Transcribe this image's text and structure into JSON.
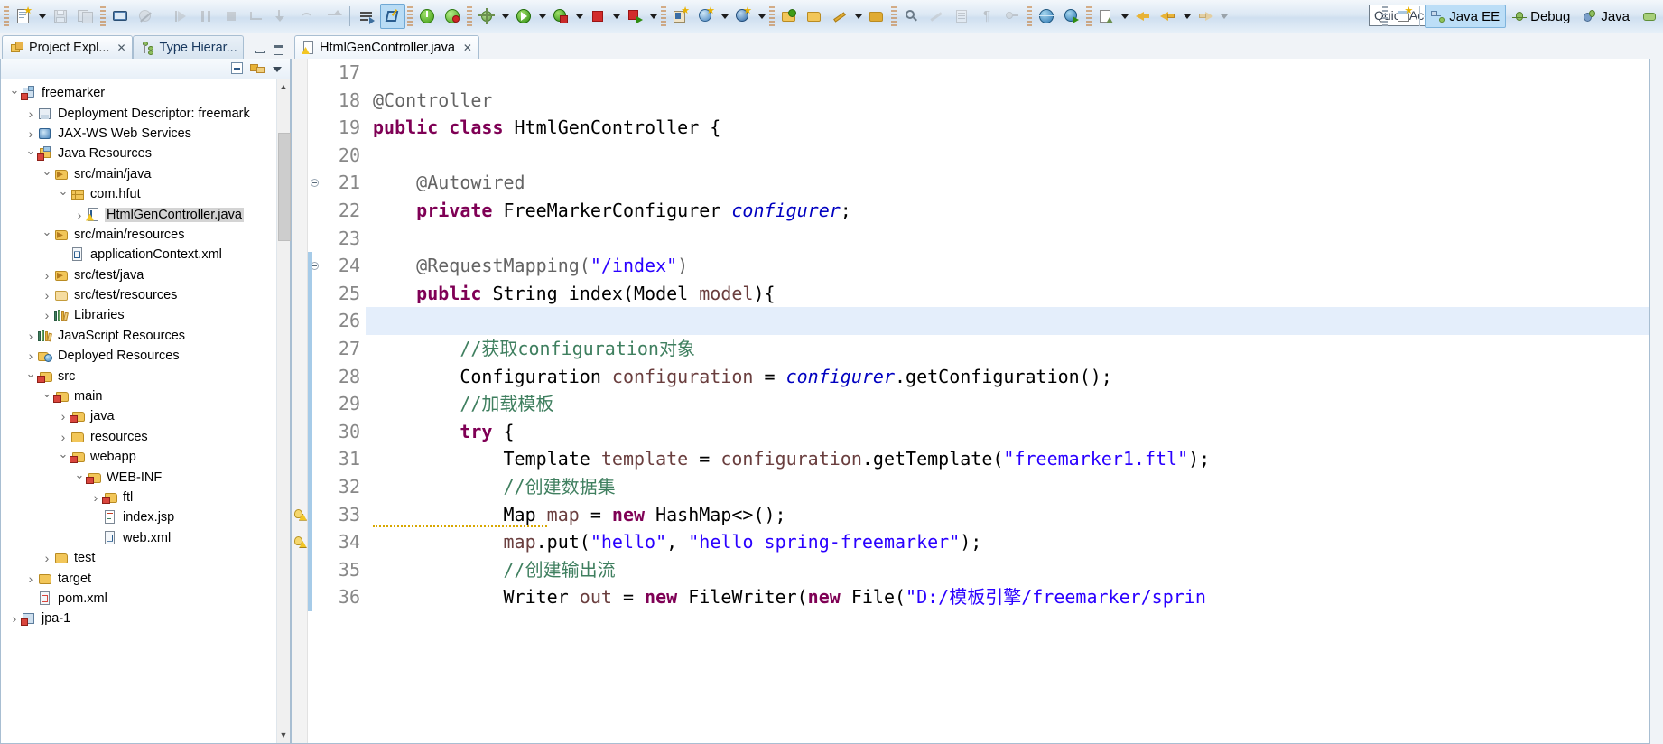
{
  "window": {
    "quick_access_placeholder": "Quick Access",
    "perspectives": [
      {
        "label": "Java EE",
        "icon": "javaee-perspective-icon",
        "selected": true
      },
      {
        "label": "Debug",
        "icon": "debug-perspective-icon",
        "selected": false
      },
      {
        "label": "Java",
        "icon": "java-perspective-icon",
        "selected": false
      }
    ],
    "open_perspective_icon": "open-perspective-icon"
  },
  "toolbar": {
    "groups": [
      {
        "name": "file",
        "items": [
          {
            "icon": "new-wizard-icon",
            "enabled": true,
            "dropdown": true
          },
          {
            "icon": "save-icon",
            "enabled": false
          },
          {
            "icon": "save-all-icon",
            "enabled": false
          }
        ]
      },
      {
        "name": "print-group",
        "items": [
          {
            "icon": "print-icon",
            "enabled": true
          },
          {
            "icon": "toggle-breakpoint-icon",
            "enabled": false
          }
        ]
      },
      {
        "name": "debug-step",
        "items": [
          {
            "icon": "resume-icon",
            "enabled": false
          },
          {
            "icon": "suspend-icon",
            "enabled": false
          },
          {
            "icon": "terminate-icon",
            "enabled": false
          },
          {
            "icon": "disconnect-icon",
            "enabled": false
          },
          {
            "icon": "step-into-icon",
            "enabled": false
          },
          {
            "icon": "step-over-icon",
            "enabled": false
          },
          {
            "icon": "step-return-icon",
            "enabled": false
          }
        ]
      },
      {
        "name": "build",
        "items": [
          {
            "icon": "skip-all-breakpoints-icon",
            "enabled": true
          },
          {
            "icon": "last-edit-location-icon",
            "enabled": true,
            "active": true
          }
        ]
      },
      {
        "name": "server",
        "items": [
          {
            "icon": "server-start-icon",
            "enabled": true
          },
          {
            "icon": "server-publish-icon",
            "enabled": true
          }
        ]
      },
      {
        "name": "run",
        "items": [
          {
            "icon": "debug-run-icon",
            "enabled": true,
            "dropdown": true
          },
          {
            "icon": "run-icon",
            "enabled": true,
            "dropdown": true
          },
          {
            "icon": "run-coverage-icon",
            "enabled": true,
            "dropdown": true
          },
          {
            "icon": "stop-icon",
            "enabled": true,
            "dropdown": true
          },
          {
            "icon": "run-on-server-icon",
            "enabled": true,
            "dropdown": true
          },
          {
            "icon": "profile-icon",
            "enabled": true,
            "dropdown": true
          }
        ]
      },
      {
        "name": "java-new",
        "items": [
          {
            "icon": "new-java-project-icon",
            "enabled": true
          },
          {
            "icon": "new-web-project-icon",
            "enabled": true,
            "dropdown": true
          },
          {
            "icon": "new-spring-bean-icon",
            "enabled": true,
            "dropdown": true
          }
        ]
      },
      {
        "name": "resources",
        "items": [
          {
            "icon": "open-type-icon",
            "enabled": true
          },
          {
            "icon": "open-task-icon",
            "enabled": true
          },
          {
            "icon": "new-annotation-icon",
            "enabled": true,
            "dropdown": true
          },
          {
            "icon": "open-resource-icon",
            "enabled": true
          }
        ]
      },
      {
        "name": "search",
        "items": [
          {
            "icon": "search-icon",
            "enabled": true
          },
          {
            "icon": "pencil-icon",
            "enabled": false
          },
          {
            "icon": "outline-icon",
            "enabled": false
          },
          {
            "icon": "paragraph-icon",
            "enabled": false
          },
          {
            "icon": "link-icon",
            "enabled": false
          }
        ]
      },
      {
        "name": "web",
        "items": [
          {
            "icon": "globe-icon",
            "enabled": true
          },
          {
            "icon": "web-run-icon",
            "enabled": true
          }
        ]
      },
      {
        "name": "nav",
        "items": [
          {
            "icon": "external-tools-icon",
            "enabled": true,
            "dropdown": true
          },
          {
            "icon": "previous-annotation-icon",
            "enabled": true,
            "dropdown": true
          },
          {
            "icon": "next-annotation-icon",
            "enabled": true
          },
          {
            "icon": "back-icon",
            "enabled": true,
            "dropdown": true
          },
          {
            "icon": "forward-icon",
            "enabled": true,
            "dropdown": true
          }
        ]
      }
    ]
  },
  "left_panel": {
    "tabs": [
      {
        "label": "Project Expl...",
        "icon": "project-explorer-icon",
        "active": true,
        "closable": true
      },
      {
        "label": "Type Hierar...",
        "icon": "type-hierarchy-icon",
        "active": false,
        "closable": false
      }
    ],
    "window_buttons": [
      "minimize-view-button",
      "maximize-view-button"
    ],
    "view_toolbar": [
      "collapse-all-icon",
      "link-with-editor-icon",
      "view-menu-icon"
    ],
    "tree": [
      {
        "depth": 0,
        "label": "freemarker",
        "icon": "maven-web-project-icon",
        "state": "open"
      },
      {
        "depth": 1,
        "label": "Deployment Descriptor: freemark",
        "icon": "deployment-descriptor-icon",
        "state": "closed"
      },
      {
        "depth": 1,
        "label": "JAX-WS Web Services",
        "icon": "jaxws-icon",
        "state": "closed"
      },
      {
        "depth": 1,
        "label": "Java Resources",
        "icon": "java-resources-icon",
        "state": "open"
      },
      {
        "depth": 2,
        "label": "src/main/java",
        "icon": "source-folder-icon",
        "state": "open"
      },
      {
        "depth": 3,
        "label": "com.hfut",
        "icon": "package-icon",
        "state": "open"
      },
      {
        "depth": 4,
        "label": "HtmlGenController.java",
        "icon": "java-file-warning-icon",
        "state": "closed",
        "selected": true
      },
      {
        "depth": 2,
        "label": "src/main/resources",
        "icon": "source-folder-icon",
        "state": "open"
      },
      {
        "depth": 3,
        "label": "applicationContext.xml",
        "icon": "xml-file-icon",
        "state": "leaf"
      },
      {
        "depth": 2,
        "label": "src/test/java",
        "icon": "source-folder-icon",
        "state": "closed"
      },
      {
        "depth": 2,
        "label": "src/test/resources",
        "icon": "source-folder-empty-icon",
        "state": "closed"
      },
      {
        "depth": 2,
        "label": "Libraries",
        "icon": "libraries-icon",
        "state": "closed"
      },
      {
        "depth": 1,
        "label": "JavaScript Resources",
        "icon": "libraries-icon",
        "state": "closed"
      },
      {
        "depth": 1,
        "label": "Deployed Resources",
        "icon": "deployed-resources-icon",
        "state": "closed"
      },
      {
        "depth": 1,
        "label": "src",
        "icon": "folder-warning-icon",
        "state": "open"
      },
      {
        "depth": 2,
        "label": "main",
        "icon": "folder-warning-icon",
        "state": "open"
      },
      {
        "depth": 3,
        "label": "java",
        "icon": "folder-warning-icon",
        "state": "closed"
      },
      {
        "depth": 3,
        "label": "resources",
        "icon": "folder-icon",
        "state": "closed"
      },
      {
        "depth": 3,
        "label": "webapp",
        "icon": "folder-warning-icon",
        "state": "open"
      },
      {
        "depth": 4,
        "label": "WEB-INF",
        "icon": "folder-warning-icon",
        "state": "open"
      },
      {
        "depth": 5,
        "label": "ftl",
        "icon": "folder-warning-icon",
        "state": "closed"
      },
      {
        "depth": 5,
        "label": "index.jsp",
        "icon": "jsp-file-icon",
        "state": "leaf"
      },
      {
        "depth": 5,
        "label": "web.xml",
        "icon": "xml-file-icon",
        "state": "leaf"
      },
      {
        "depth": 2,
        "label": "test",
        "icon": "folder-icon",
        "state": "closed"
      },
      {
        "depth": 1,
        "label": "target",
        "icon": "folder-icon",
        "state": "closed"
      },
      {
        "depth": 1,
        "label": "pom.xml",
        "icon": "pom-file-icon",
        "state": "leaf"
      },
      {
        "depth": 0,
        "label": "jpa-1",
        "icon": "java-project-icon",
        "state": "closed"
      }
    ]
  },
  "editor": {
    "tab": {
      "label": "HtmlGenController.java",
      "icon": "java-file-warning-icon",
      "closable": true
    },
    "current_line": 26,
    "lines": [
      {
        "n": 17,
        "tokens": [],
        "marker": null,
        "fold": null,
        "change": false
      },
      {
        "n": 18,
        "tokens": [
          {
            "t": "@Controller",
            "c": "ann"
          }
        ],
        "marker": null,
        "fold": null,
        "change": false
      },
      {
        "n": 19,
        "tokens": [
          {
            "t": "public",
            "c": "kw"
          },
          {
            "t": " ",
            "c": ""
          },
          {
            "t": "class",
            "c": "kw"
          },
          {
            "t": " HtmlGenController {",
            "c": ""
          }
        ],
        "marker": null,
        "fold": null,
        "change": false
      },
      {
        "n": 20,
        "tokens": [],
        "marker": null,
        "fold": null,
        "change": false
      },
      {
        "n": 21,
        "tokens": [
          {
            "t": "    @Autowired",
            "c": "ann"
          }
        ],
        "marker": null,
        "fold": "collapse",
        "change": false
      },
      {
        "n": 22,
        "tokens": [
          {
            "t": "    ",
            "c": ""
          },
          {
            "t": "private",
            "c": "kw"
          },
          {
            "t": " FreeMarkerConfigurer ",
            "c": ""
          },
          {
            "t": "configurer",
            "c": "fld2"
          },
          {
            "t": ";",
            "c": ""
          }
        ],
        "marker": null,
        "fold": null,
        "change": false
      },
      {
        "n": 23,
        "tokens": [],
        "marker": null,
        "fold": null,
        "change": false
      },
      {
        "n": 24,
        "tokens": [
          {
            "t": "    @RequestMapping(",
            "c": "ann"
          },
          {
            "t": "\"/index\"",
            "c": "str"
          },
          {
            "t": ")",
            "c": "ann"
          }
        ],
        "marker": null,
        "fold": "collapse",
        "change": true
      },
      {
        "n": 25,
        "tokens": [
          {
            "t": "    ",
            "c": ""
          },
          {
            "t": "public",
            "c": "kw"
          },
          {
            "t": " String index(Model ",
            "c": ""
          },
          {
            "t": "model",
            "c": "lv"
          },
          {
            "t": "){",
            "c": ""
          }
        ],
        "marker": null,
        "fold": null,
        "change": true
      },
      {
        "n": 26,
        "tokens": [],
        "marker": null,
        "fold": null,
        "change": true
      },
      {
        "n": 27,
        "tokens": [
          {
            "t": "        //获取configuration对象",
            "c": "cm"
          }
        ],
        "marker": null,
        "fold": null,
        "change": true
      },
      {
        "n": 28,
        "tokens": [
          {
            "t": "        Configuration ",
            "c": ""
          },
          {
            "t": "configuration",
            "c": "lv"
          },
          {
            "t": " = ",
            "c": ""
          },
          {
            "t": "configurer",
            "c": "fld2"
          },
          {
            "t": ".getConfiguration();",
            "c": ""
          }
        ],
        "marker": null,
        "fold": null,
        "change": true
      },
      {
        "n": 29,
        "tokens": [
          {
            "t": "        //加载模板",
            "c": "cm"
          }
        ],
        "marker": null,
        "fold": null,
        "change": true
      },
      {
        "n": 30,
        "tokens": [
          {
            "t": "        ",
            "c": ""
          },
          {
            "t": "try",
            "c": "kw"
          },
          {
            "t": " {",
            "c": ""
          }
        ],
        "marker": null,
        "fold": null,
        "change": true
      },
      {
        "n": 31,
        "tokens": [
          {
            "t": "            Template ",
            "c": ""
          },
          {
            "t": "template",
            "c": "lv"
          },
          {
            "t": " = ",
            "c": ""
          },
          {
            "t": "configuration",
            "c": "lv"
          },
          {
            "t": ".getTemplate(",
            "c": ""
          },
          {
            "t": "\"freemarker1.ftl\"",
            "c": "str"
          },
          {
            "t": ");",
            "c": ""
          }
        ],
        "marker": null,
        "fold": null,
        "change": true
      },
      {
        "n": 32,
        "tokens": [
          {
            "t": "            //创建数据集",
            "c": "cm"
          }
        ],
        "marker": null,
        "fold": null,
        "change": true
      },
      {
        "n": 33,
        "tokens": [
          {
            "t": "            Map ",
            "c": "warn"
          },
          {
            "t": "map",
            "c": "lv"
          },
          {
            "t": " = ",
            "c": ""
          },
          {
            "t": "new",
            "c": "kw"
          },
          {
            "t": " HashMap<>();",
            "c": ""
          }
        ],
        "marker": "warning-quickfix",
        "fold": null,
        "change": true
      },
      {
        "n": 34,
        "tokens": [
          {
            "t": "            ",
            "c": ""
          },
          {
            "t": "map",
            "c": "lv"
          },
          {
            "t": ".put(",
            "c": ""
          },
          {
            "t": "\"hello\"",
            "c": "str"
          },
          {
            "t": ", ",
            "c": ""
          },
          {
            "t": "\"hello spring-freemarker\"",
            "c": "str"
          },
          {
            "t": ");",
            "c": ""
          }
        ],
        "marker": "warning-quickfix",
        "fold": null,
        "change": true
      },
      {
        "n": 35,
        "tokens": [
          {
            "t": "            //创建输出流",
            "c": "cm"
          }
        ],
        "marker": null,
        "fold": null,
        "change": true
      },
      {
        "n": 36,
        "tokens": [
          {
            "t": "            Writer ",
            "c": ""
          },
          {
            "t": "out",
            "c": "lv"
          },
          {
            "t": " = ",
            "c": ""
          },
          {
            "t": "new",
            "c": "kw"
          },
          {
            "t": " FileWriter(",
            "c": ""
          },
          {
            "t": "new",
            "c": "kw"
          },
          {
            "t": " File(",
            "c": ""
          },
          {
            "t": "\"D:/模板引擎/freemarker/sprin",
            "c": "str"
          }
        ],
        "marker": null,
        "fold": null,
        "change": true
      }
    ]
  },
  "colors": {
    "keyword": "#7f0055",
    "string": "#2a00ff",
    "comment": "#3f7f5f",
    "annotation": "#646464",
    "field": "#0000c0",
    "local_var": "#6a3e3e",
    "current_line_bg": "#e4eefb",
    "selection_bg": "#d4d4d4",
    "accent": "#bcdef7"
  }
}
